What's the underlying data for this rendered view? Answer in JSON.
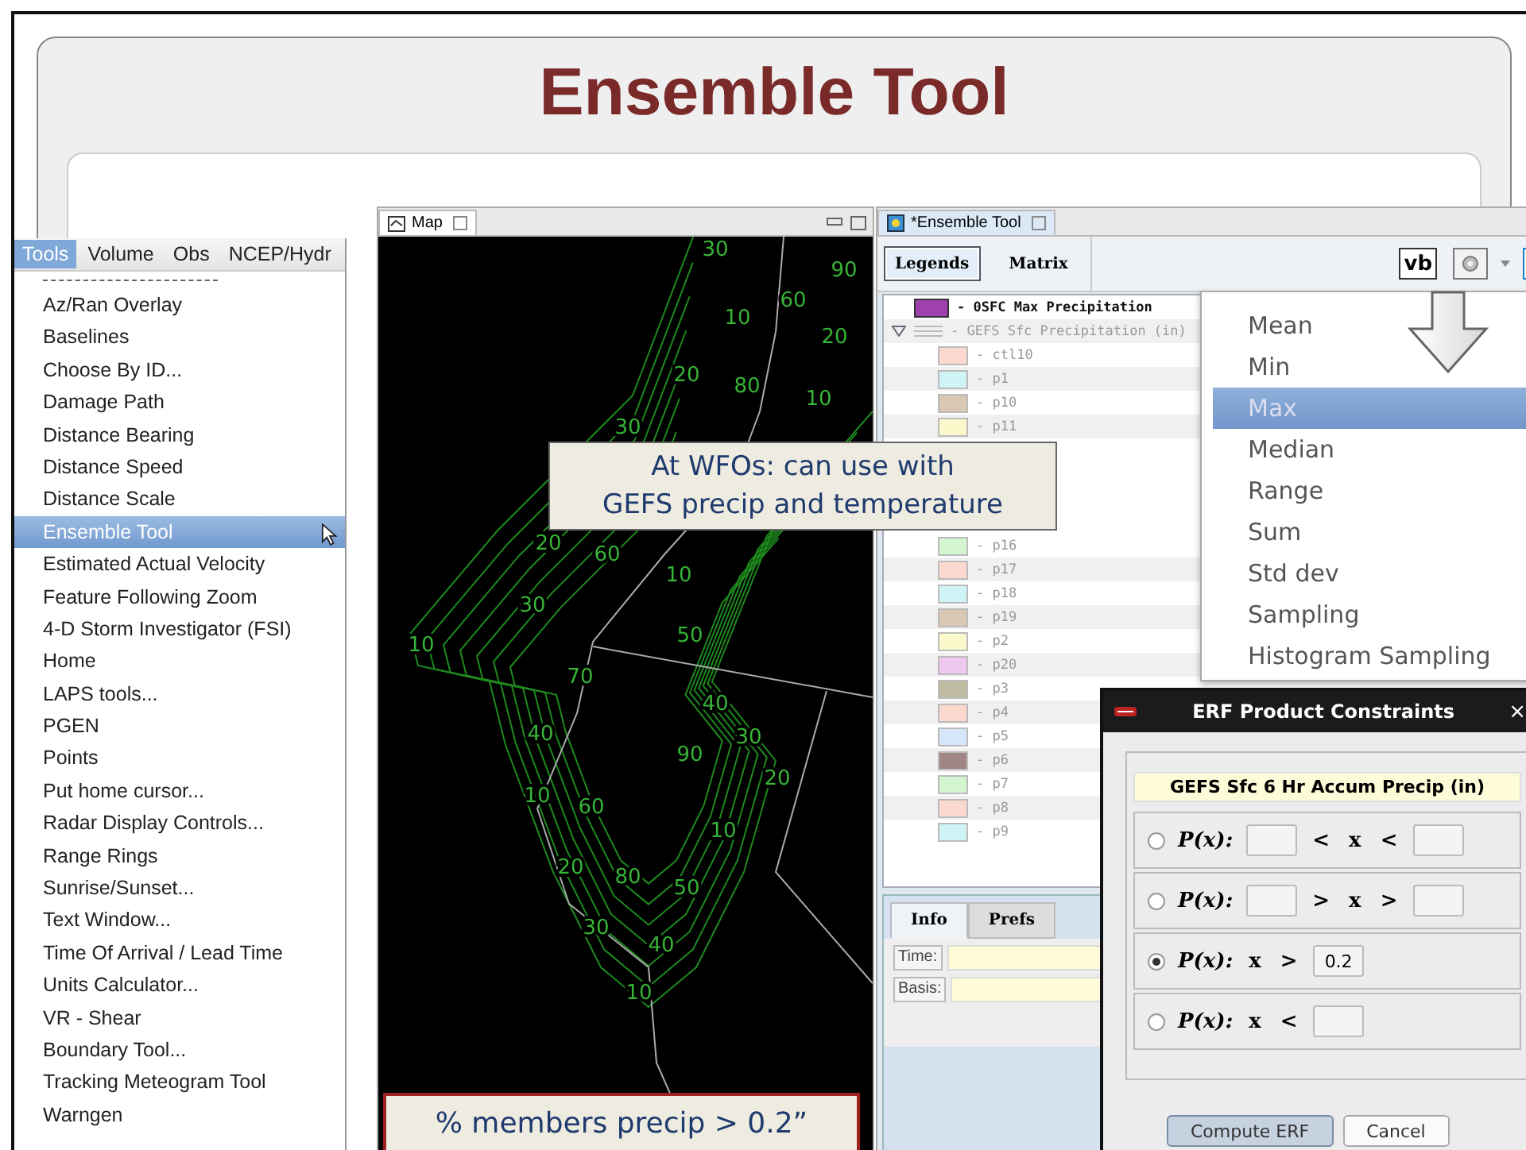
{
  "slide": {
    "title": "Ensemble Tool"
  },
  "tools_menu": {
    "menubar": [
      {
        "label": "Tools",
        "selected": true
      },
      {
        "label": "Volume",
        "selected": false
      },
      {
        "label": "Obs",
        "selected": false
      },
      {
        "label": "NCEP/Hydr",
        "selected": false
      }
    ],
    "items": [
      {
        "label": "Az/Ran Overlay",
        "selected": false
      },
      {
        "label": "Baselines",
        "selected": false
      },
      {
        "label": "Choose By ID...",
        "selected": false
      },
      {
        "label": "Damage Path",
        "selected": false
      },
      {
        "label": "Distance Bearing",
        "selected": false
      },
      {
        "label": "Distance Speed",
        "selected": false
      },
      {
        "label": "Distance Scale",
        "selected": false
      },
      {
        "label": "Ensemble Tool",
        "selected": true
      },
      {
        "label": "Estimated Actual Velocity",
        "selected": false
      },
      {
        "label": "Feature Following Zoom",
        "selected": false
      },
      {
        "label": "4-D Storm Investigator (FSI)",
        "selected": false
      },
      {
        "label": "Home",
        "selected": false
      },
      {
        "label": "LAPS tools...",
        "selected": false
      },
      {
        "label": "PGEN",
        "selected": false
      },
      {
        "label": "Points",
        "selected": false
      },
      {
        "label": "Put home cursor...",
        "selected": false
      },
      {
        "label": "Radar Display Controls...",
        "selected": false
      },
      {
        "label": "Range Rings",
        "selected": false
      },
      {
        "label": "Sunrise/Sunset...",
        "selected": false
      },
      {
        "label": "Text Window...",
        "selected": false
      },
      {
        "label": "Time Of Arrival / Lead Time",
        "selected": false
      },
      {
        "label": "Units Calculator...",
        "selected": false
      },
      {
        "label": "VR - Shear",
        "selected": false
      },
      {
        "label": "Boundary Tool...",
        "selected": false
      },
      {
        "label": "Tracking Meteogram Tool",
        "selected": false
      },
      {
        "label": "Warngen",
        "selected": false
      }
    ]
  },
  "map_window": {
    "tab": "Map",
    "contour_labels": [
      "30",
      "90",
      "60",
      "10",
      "20",
      "20",
      "80",
      "10",
      "30",
      "20",
      "60",
      "10",
      "30",
      "10",
      "50",
      "70",
      "40",
      "30",
      "40",
      "90",
      "20",
      "10",
      "60",
      "10",
      "20",
      "80",
      "50",
      "30",
      "40",
      "10"
    ]
  },
  "note_top": "At WFOs: can use with\nGEFS precip and temperature",
  "note_bottom": "% members precip > 0.2”",
  "ensemble_window": {
    "tab": "*Ensemble Tool",
    "view_tabs": [
      {
        "label": "Legends",
        "selected": true
      },
      {
        "label": "Matrix",
        "selected": false
      }
    ],
    "toolbar_button": "vb",
    "legend": {
      "resource": {
        "label": "- 0SFC Max Precipitation",
        "color": "#a040b0"
      },
      "group": {
        "label": "- GEFS Sfc Precipitation (in)",
        "expanded": true,
        "children": [
          {
            "label": "- ctl10",
            "color": "#fcd9cf"
          },
          {
            "label": "- p1",
            "color": "#d0f4f6"
          },
          {
            "label": "- p10",
            "color": "#d9c8b4"
          },
          {
            "label": "- p11",
            "color": "#fbf9cc"
          },
          {
            "label": "- p16",
            "color": "#d3f5d0"
          },
          {
            "label": "- p17",
            "color": "#fcd9cf"
          },
          {
            "label": "- p18",
            "color": "#d0f4f6"
          },
          {
            "label": "- p19",
            "color": "#d9c8b4"
          },
          {
            "label": "- p2",
            "color": "#fbf9cc"
          },
          {
            "label": "- p20",
            "color": "#efc8ef"
          },
          {
            "label": "- p3",
            "color": "#bfbba0"
          },
          {
            "label": "- p4",
            "color": "#fcd9cf"
          },
          {
            "label": "- p5",
            "color": "#d5e6f8"
          },
          {
            "label": "- p6",
            "color": "#a08585"
          },
          {
            "label": "- p7",
            "color": "#d3f5d0"
          },
          {
            "label": "- p8",
            "color": "#fcd9cf"
          },
          {
            "label": "- p9",
            "color": "#d0f4f6"
          }
        ]
      }
    },
    "info_tabs": [
      {
        "label": "Info",
        "selected": true
      },
      {
        "label": "Prefs",
        "selected": false
      }
    ],
    "info_fields": [
      {
        "label": "Time:"
      },
      {
        "label": "Basis:"
      }
    ]
  },
  "stat_menu": {
    "items": [
      {
        "label": "Mean",
        "selected": false
      },
      {
        "label": "Min",
        "selected": false
      },
      {
        "label": "Max",
        "selected": true
      },
      {
        "label": "Median",
        "selected": false
      },
      {
        "label": "Range",
        "selected": false
      },
      {
        "label": "Sum",
        "selected": false
      },
      {
        "label": "Std dev",
        "selected": false
      },
      {
        "label": "Sampling",
        "selected": false
      },
      {
        "label": "Histogram Sampling",
        "selected": false
      }
    ]
  },
  "erf_dialog": {
    "title": "ERF Product Constraints",
    "close": "×",
    "product": "GEFS Sfc 6 Hr Accum Precip (in)",
    "options": [
      {
        "selected": false,
        "parts": [
          {
            "kind": "label",
            "text": "P(x):"
          },
          {
            "kind": "field"
          },
          {
            "kind": "op",
            "text": "<"
          },
          {
            "kind": "op",
            "text": "x"
          },
          {
            "kind": "op",
            "text": "<"
          },
          {
            "kind": "field"
          }
        ]
      },
      {
        "selected": false,
        "parts": [
          {
            "kind": "label",
            "text": "P(x):"
          },
          {
            "kind": "field"
          },
          {
            "kind": "op",
            "text": ">"
          },
          {
            "kind": "op",
            "text": "x"
          },
          {
            "kind": "op",
            "text": ">"
          },
          {
            "kind": "field"
          }
        ]
      },
      {
        "selected": true,
        "parts": [
          {
            "kind": "label",
            "text": "P(x):"
          },
          {
            "kind": "op",
            "text": "x"
          },
          {
            "kind": "op",
            "text": ">"
          },
          {
            "kind": "field",
            "value": "0.2"
          }
        ]
      },
      {
        "selected": false,
        "parts": [
          {
            "kind": "label",
            "text": "P(x):"
          },
          {
            "kind": "op",
            "text": "x"
          },
          {
            "kind": "op",
            "text": "<"
          },
          {
            "kind": "field"
          }
        ]
      }
    ],
    "buttons": [
      "Compute ERF",
      "Cancel"
    ]
  }
}
